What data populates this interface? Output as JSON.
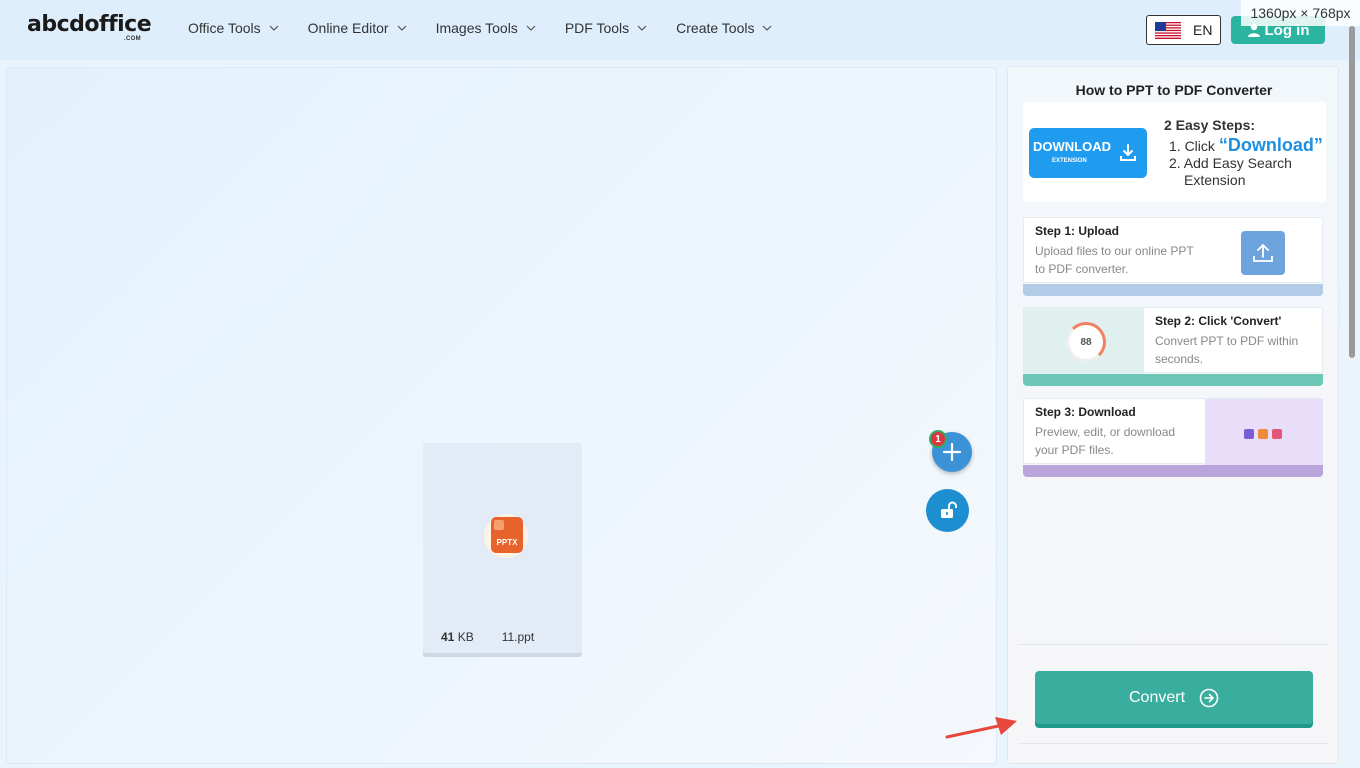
{
  "header": {
    "logo": "abcdoffice",
    "logo_sub": ".COM",
    "nav": [
      {
        "label": "Office Tools"
      },
      {
        "label": "Online Editor"
      },
      {
        "label": "Images Tools"
      },
      {
        "label": "PDF Tools"
      },
      {
        "label": "Create Tools"
      }
    ],
    "lang": "EN",
    "login": "Log in",
    "size_readout": "1360px × 768px"
  },
  "workspace": {
    "file": {
      "type_label": "PPTX",
      "size_value": "41",
      "size_unit": "KB",
      "name": "11.ppt"
    },
    "badge_count": "1"
  },
  "panel": {
    "title": "How to PPT to PDF Converter",
    "promo": {
      "download_label": "DOWNLOAD",
      "extension_label": "EXTENSION",
      "steps_head": "2 Easy Steps:",
      "step1_prefix": "1. Click",
      "step1_word": "“Download”",
      "step2_line1": "2. Add Easy Search",
      "step2_line2": "Extension"
    },
    "steps": [
      {
        "title": "Step 1: Upload",
        "desc": "Upload files to our online PPT to PDF converter."
      },
      {
        "title": "Step 2: Click 'Convert'",
        "desc": "Convert PPT to PDF within seconds.",
        "progress_value": "88"
      },
      {
        "title": "Step 3: Download",
        "desc": "Preview, edit, or download your PDF files."
      }
    ],
    "convert_label": "Convert"
  },
  "colors": {
    "accent_teal": "#39ad9e",
    "blue": "#1f9bf0",
    "badge_red": "#d9363e",
    "arrow_red": "#e8483c"
  }
}
